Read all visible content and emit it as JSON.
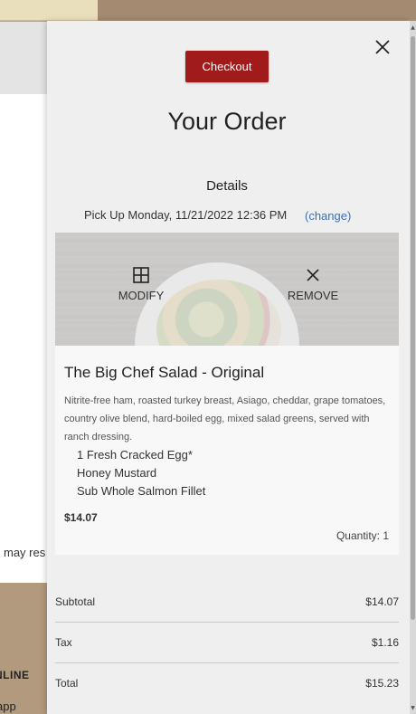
{
  "background": {
    "partial_text_1": "may res",
    "partial_text_2": "NLINE",
    "partial_text_3": "app"
  },
  "drawer": {
    "checkout_label": "Checkout",
    "title": "Your Order",
    "details_heading": "Details",
    "pickup_text": "Pick Up Monday, 11/21/2022 12:36 PM",
    "change_link": "(change)",
    "close_icon": "close-icon"
  },
  "item": {
    "modify_label": "MODIFY",
    "remove_label": "REMOVE",
    "name": "The Big Chef Salad - Original",
    "description": "Nitrite-free ham, roasted turkey breast, Asiago, cheddar, grape tomatoes, country olive blend, hard-boiled egg, mixed salad greens, served with ranch dressing.",
    "modifiers": [
      "1 Fresh Cracked Egg*",
      "Honey Mustard",
      "Sub Whole Salmon Fillet"
    ],
    "price": "$14.07",
    "quantity": "Quantity: 1"
  },
  "totals": {
    "subtotal_label": "Subtotal",
    "subtotal_value": "$14.07",
    "tax_label": "Tax",
    "tax_value": "$1.16",
    "total_label": "Total",
    "total_value": "$15.23"
  },
  "colors": {
    "checkout_button": "#a21b1b",
    "link": "#3a70b5",
    "drawer_bg": "#efefef"
  }
}
